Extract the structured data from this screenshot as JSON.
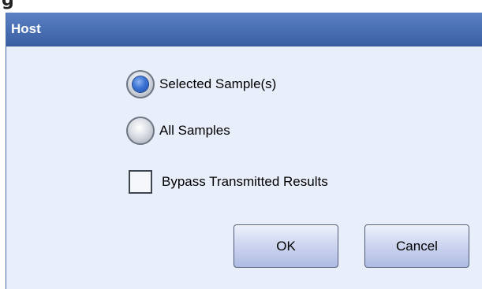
{
  "page_top_fragment": "g",
  "dialog": {
    "title": "Host",
    "options": [
      {
        "label": "Selected Sample(s)",
        "selected": true
      },
      {
        "label": "All Samples",
        "selected": false
      }
    ],
    "checkbox": {
      "label": "Bypass Transmitted Results",
      "checked": false
    },
    "buttons": {
      "ok": "OK",
      "cancel": "Cancel"
    }
  },
  "colors": {
    "title_bar": "#4a70b4",
    "dialog_background": "#e9eefb",
    "radio_selected": "#3b74d6",
    "button": "#cfd7f0"
  }
}
